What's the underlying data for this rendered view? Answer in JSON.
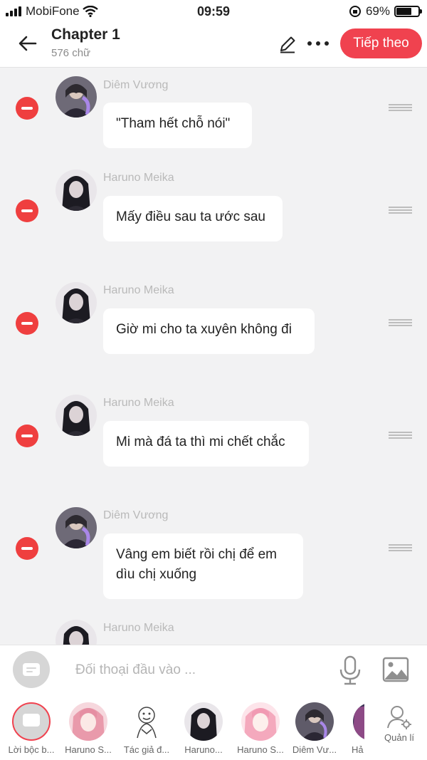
{
  "status_bar": {
    "carrier": "MobiFone",
    "time": "09:59",
    "battery_percent": "69%",
    "battery_level": 0.69
  },
  "header": {
    "title": "Chapter 1",
    "subtitle": "576 chữ",
    "next_button": "Tiếp theo"
  },
  "messages": [
    {
      "author": "Diêm Vương",
      "text": "\"Tham hết chỗ nói\"",
      "avatar": "dark-haired-man-purple-flame"
    },
    {
      "author": "Haruno Meika",
      "text": "Mấy điều sau ta ước sau",
      "avatar": "dark-haired-girl"
    },
    {
      "author": "Haruno Meika",
      "text": "Giờ mi cho ta xuyên không đi",
      "avatar": "dark-haired-girl"
    },
    {
      "author": "Haruno Meika",
      "text": "Mi mà đá ta thì mi chết chắc",
      "avatar": "dark-haired-girl"
    },
    {
      "author": "Diêm Vương",
      "text_lines": [
        "Vâng em biết rồi chị để em",
        "dìu chị xuống"
      ],
      "avatar": "dark-haired-man-purple-flame"
    },
    {
      "author": "Haruno Meika",
      "text": "",
      "avatar": "dark-haired-girl"
    }
  ],
  "input": {
    "placeholder": "Đối thoại đầu vào ..."
  },
  "characters": [
    {
      "label": "Lời bộc b...",
      "type": "narration"
    },
    {
      "label": "Haruno S...",
      "type": "pink-hair"
    },
    {
      "label": "Tác giả đ...",
      "type": "sketch"
    },
    {
      "label": "Haruno...",
      "type": "dark-hair"
    },
    {
      "label": "Haruno S...",
      "type": "pink-hair-light"
    },
    {
      "label": "Diêm Vư...",
      "type": "dark-man"
    },
    {
      "label": "Hả",
      "type": "partial"
    }
  ],
  "manage_label": "Quản lí",
  "colors": {
    "accent": "#f0424f",
    "delete": "#ef3f3f",
    "background": "#f2f2f3"
  }
}
